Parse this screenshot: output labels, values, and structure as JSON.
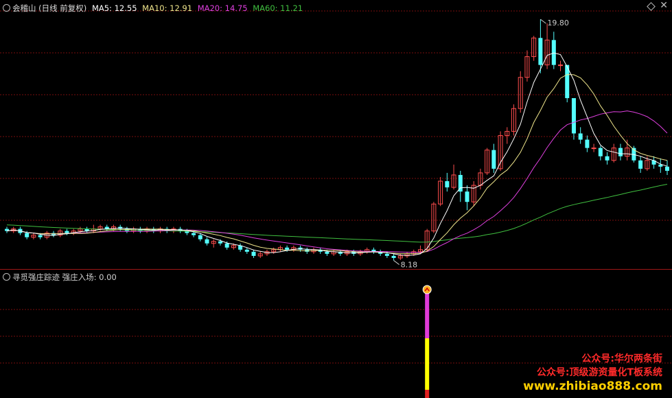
{
  "legend": {
    "title": "会稽山 (日线 前复权)",
    "ma5": "MA5: 12.55",
    "ma10": "MA10: 12.91",
    "ma20": "MA20: 14.75",
    "ma60": "MA60: 11.21"
  },
  "sub_legend": {
    "indicator": "寻觅强庄踪迹",
    "value": "强庄入场: 0.00"
  },
  "annotations": {
    "high_label": "19.80",
    "low_label": "8.18"
  },
  "watermark": {
    "line1": "公众号:华尔两条街",
    "line2": "公众号:顶级游资量化T板系统",
    "line3": "www.zhibiao888.com"
  },
  "colors": {
    "up": "#ff4d4d",
    "down": "#54ffff",
    "ma5": "#ffffff",
    "ma10": "#f0e68c",
    "ma20": "#e040e0",
    "ma60": "#40c040",
    "grid": "#7a0e0e",
    "signal_top": "#e03ad8",
    "signal_bottom": "#ffff00"
  },
  "chart_data": {
    "type": "candlestick",
    "y_range": [
      8.0,
      20.2
    ],
    "high": 19.8,
    "low": 8.18,
    "candles": [
      [
        9.7,
        9.6,
        9.8,
        9.5
      ],
      [
        9.6,
        9.7,
        9.8,
        9.5
      ],
      [
        9.7,
        9.5,
        9.8,
        9.4
      ],
      [
        9.5,
        9.3,
        9.6,
        9.2
      ],
      [
        9.3,
        9.4,
        9.5,
        9.2
      ],
      [
        9.4,
        9.3,
        9.5,
        9.2
      ],
      [
        9.3,
        9.5,
        9.6,
        9.2
      ],
      [
        9.5,
        9.4,
        9.6,
        9.3
      ],
      [
        9.4,
        9.6,
        9.7,
        9.3
      ],
      [
        9.6,
        9.5,
        9.7,
        9.4
      ],
      [
        9.5,
        9.6,
        9.7,
        9.4
      ],
      [
        9.6,
        9.7,
        9.8,
        9.5
      ],
      [
        9.7,
        9.6,
        9.8,
        9.5
      ],
      [
        9.6,
        9.7,
        9.9,
        9.5
      ],
      [
        9.7,
        9.8,
        9.9,
        9.6
      ],
      [
        9.8,
        9.7,
        9.9,
        9.6
      ],
      [
        9.7,
        9.8,
        9.9,
        9.6
      ],
      [
        9.8,
        9.7,
        9.9,
        9.6
      ],
      [
        9.7,
        9.6,
        9.8,
        9.5
      ],
      [
        9.6,
        9.7,
        9.8,
        9.5
      ],
      [
        9.7,
        9.6,
        9.8,
        9.5
      ],
      [
        9.6,
        9.7,
        9.8,
        9.5
      ],
      [
        9.7,
        9.6,
        9.8,
        9.5
      ],
      [
        9.6,
        9.7,
        9.8,
        9.5
      ],
      [
        9.7,
        9.6,
        9.8,
        9.5
      ],
      [
        9.6,
        9.7,
        9.8,
        9.5
      ],
      [
        9.7,
        9.6,
        9.8,
        9.5
      ],
      [
        9.6,
        9.5,
        9.7,
        9.4
      ],
      [
        9.5,
        9.4,
        9.6,
        9.3
      ],
      [
        9.4,
        9.2,
        9.5,
        9.1
      ],
      [
        9.2,
        9.0,
        9.3,
        8.9
      ],
      [
        9.0,
        9.1,
        9.2,
        8.8
      ],
      [
        9.1,
        9.0,
        9.2,
        8.9
      ],
      [
        9.0,
        8.8,
        9.1,
        8.7
      ],
      [
        8.8,
        8.9,
        9.0,
        8.7
      ],
      [
        8.9,
        8.7,
        9.0,
        8.6
      ],
      [
        8.7,
        8.6,
        8.8,
        8.5
      ],
      [
        8.6,
        8.4,
        8.7,
        8.3
      ],
      [
        8.4,
        8.5,
        8.6,
        8.3
      ],
      [
        8.5,
        8.6,
        8.7,
        8.4
      ],
      [
        8.6,
        8.7,
        8.8,
        8.5
      ],
      [
        8.7,
        8.8,
        8.9,
        8.6
      ],
      [
        8.8,
        8.7,
        8.9,
        8.6
      ],
      [
        8.7,
        8.8,
        8.9,
        8.6
      ],
      [
        8.8,
        8.7,
        8.9,
        8.6
      ],
      [
        8.7,
        8.6,
        8.8,
        8.5
      ],
      [
        8.6,
        8.7,
        8.8,
        8.5
      ],
      [
        8.7,
        8.6,
        8.8,
        8.5
      ],
      [
        8.6,
        8.5,
        8.7,
        8.4
      ],
      [
        8.5,
        8.6,
        8.7,
        8.4
      ],
      [
        8.6,
        8.5,
        8.7,
        8.4
      ],
      [
        8.5,
        8.6,
        8.7,
        8.4
      ],
      [
        8.6,
        8.5,
        8.7,
        8.4
      ],
      [
        8.5,
        8.6,
        8.7,
        8.4
      ],
      [
        8.6,
        8.7,
        8.8,
        8.5
      ],
      [
        8.7,
        8.6,
        8.8,
        8.5
      ],
      [
        8.6,
        8.5,
        8.7,
        8.4
      ],
      [
        8.5,
        8.4,
        8.6,
        8.3
      ],
      [
        8.4,
        8.3,
        8.5,
        8.18
      ],
      [
        8.3,
        8.4,
        8.5,
        8.2
      ],
      [
        8.4,
        8.5,
        8.6,
        8.3
      ],
      [
        8.5,
        8.6,
        8.7,
        8.4
      ],
      [
        8.6,
        8.7,
        8.9,
        8.5
      ],
      [
        8.7,
        9.6,
        9.7,
        8.6
      ],
      [
        9.6,
        10.9,
        11.0,
        9.5
      ],
      [
        10.9,
        12.0,
        12.2,
        10.8
      ],
      [
        12.0,
        11.7,
        12.4,
        11.5
      ],
      [
        11.7,
        12.3,
        12.8,
        11.6
      ],
      [
        12.3,
        11.5,
        12.5,
        11.0
      ],
      [
        11.5,
        11.0,
        11.8,
        10.6
      ],
      [
        11.0,
        11.8,
        12.0,
        10.8
      ],
      [
        11.8,
        12.4,
        12.6,
        11.6
      ],
      [
        12.4,
        13.5,
        13.6,
        12.3
      ],
      [
        13.5,
        12.6,
        13.8,
        12.4
      ],
      [
        12.6,
        14.2,
        14.4,
        12.5
      ],
      [
        14.2,
        14.4,
        14.6,
        13.8
      ],
      [
        14.4,
        15.5,
        15.7,
        14.2
      ],
      [
        15.5,
        17.0,
        17.3,
        15.3
      ],
      [
        17.0,
        18.0,
        18.3,
        16.8
      ],
      [
        18.0,
        18.9,
        19.0,
        17.8
      ],
      [
        18.9,
        17.6,
        19.8,
        17.2
      ],
      [
        17.6,
        18.8,
        19.6,
        17.4
      ],
      [
        18.8,
        17.6,
        19.2,
        17.4
      ],
      [
        17.6,
        17.6,
        17.8,
        17.3
      ],
      [
        17.6,
        16.0,
        16.2,
        15.8
      ],
      [
        16.0,
        14.3,
        14.6,
        14.0
      ],
      [
        14.3,
        14.0,
        14.6,
        13.8
      ],
      [
        14.0,
        13.6,
        14.2,
        13.4
      ],
      [
        13.6,
        13.6,
        13.8,
        13.4
      ],
      [
        13.6,
        13.2,
        13.7,
        13.0
      ],
      [
        13.2,
        13.0,
        13.4,
        12.8
      ],
      [
        13.0,
        13.6,
        13.8,
        12.9
      ],
      [
        13.6,
        13.2,
        13.8,
        13.0
      ],
      [
        13.2,
        13.6,
        14.0,
        13.0
      ],
      [
        13.6,
        13.0,
        13.7,
        12.9
      ],
      [
        13.0,
        12.6,
        13.2,
        12.4
      ],
      [
        12.6,
        13.0,
        13.2,
        12.5
      ],
      [
        13.0,
        12.8,
        13.2,
        12.6
      ],
      [
        12.8,
        12.7,
        13.1,
        12.4
      ],
      [
        12.7,
        12.5,
        13.0,
        12.3
      ]
    ],
    "signal": {
      "type": "bar",
      "bar_index": 63,
      "marker": "^",
      "segments": [
        {
          "color": "magenta",
          "level": 2
        },
        {
          "color": "yellow",
          "level": 1
        }
      ]
    }
  }
}
